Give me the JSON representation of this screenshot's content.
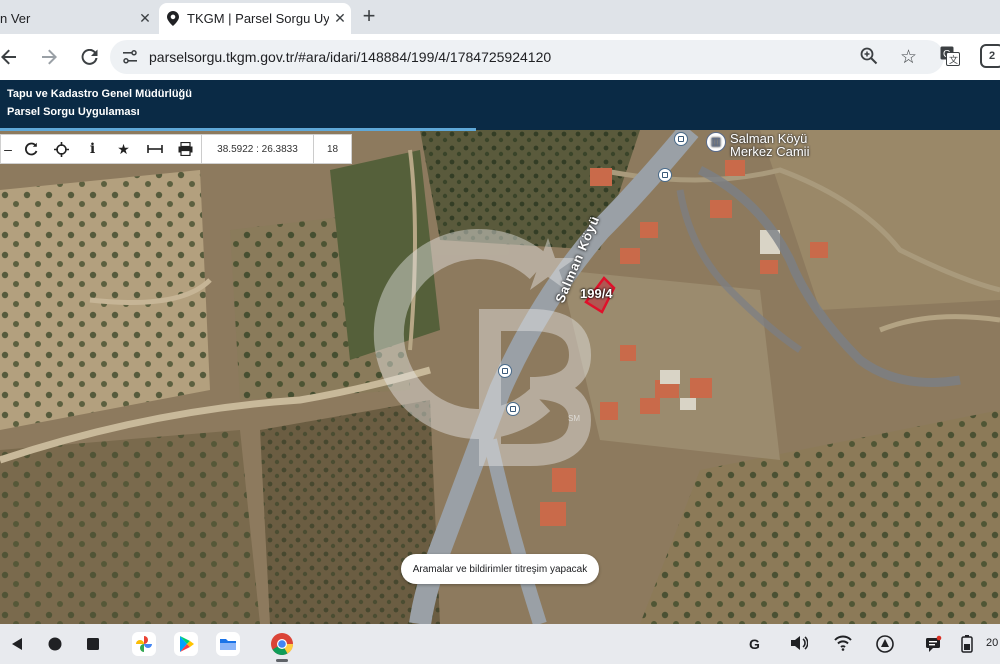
{
  "browser": {
    "tabs": [
      {
        "title": "n Ver",
        "active": false
      },
      {
        "title": "TKGM | Parsel Sorgu Uygulam",
        "active": true
      }
    ],
    "url": "parselsorgu.tkgm.gov.tr/#ara/idari/148884/199/4/1784725924120",
    "profile_count": "2"
  },
  "site": {
    "org_name": "Tapu ve Kadastro Genel Müdürlüğü",
    "app_name": "Parsel Sorgu Uygulaması"
  },
  "map_toolbar": {
    "tools": [
      "refresh-icon",
      "locate-icon",
      "info-icon",
      "star-icon",
      "measure-icon",
      "print-icon"
    ],
    "coordinates": "38.5922 : 26.3833",
    "zoom_level": "18"
  },
  "map": {
    "poi_label_line1": "Salman Köyü",
    "poi_label_line2": "Merkez Camii",
    "road_label": "Salman Köyü",
    "parcel_label": "199/4",
    "watermark": "CB",
    "watermark_tag": "SM"
  },
  "toast": {
    "message": "Aramalar ve bildirimler titreşim yapacak"
  },
  "shelf": {
    "apps": [
      "photos-app",
      "play-store-app",
      "files-app",
      "chrome-app"
    ],
    "clock": "20"
  },
  "colors": {
    "header_bg": "#0a2a45",
    "progress": "#5fa8d8",
    "parcel_outline": "#e0102a"
  }
}
